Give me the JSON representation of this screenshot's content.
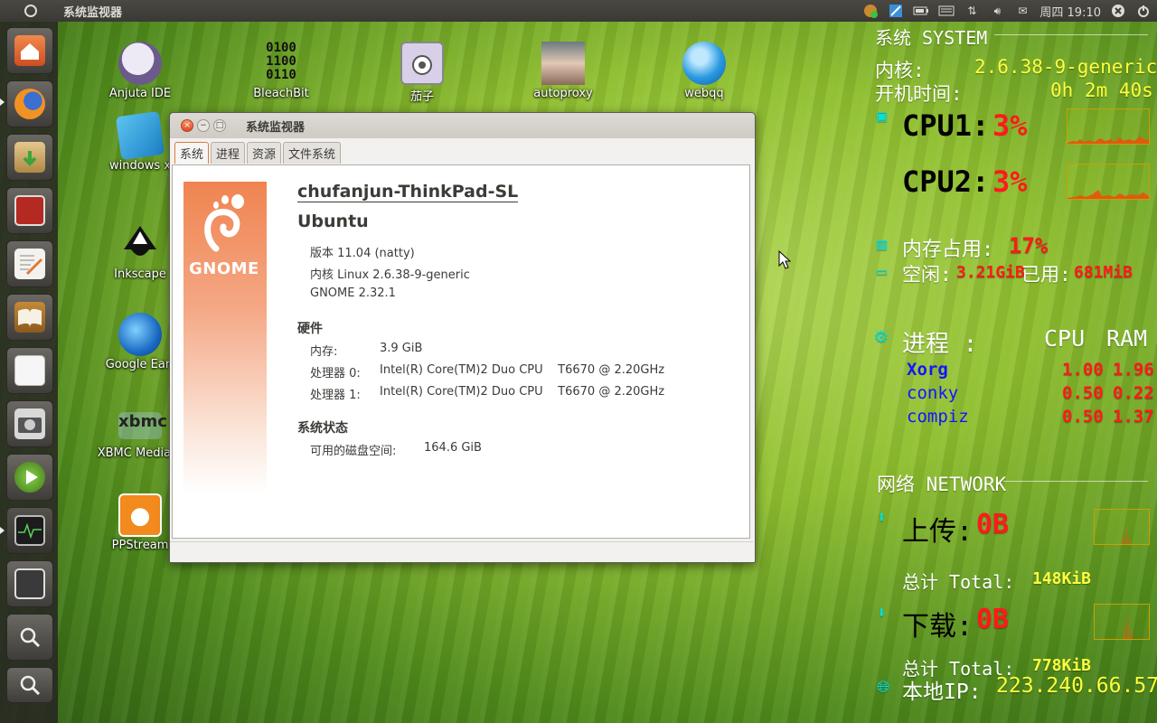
{
  "top_panel": {
    "app_title": "系统监视器",
    "clock": "周四 19:10",
    "tray_icons": [
      "notification-icon",
      "network-manager-icon",
      "battery-icon",
      "keyboard-icon",
      "transfer-icon",
      "volume-icon",
      "mail-icon",
      "power-icon"
    ]
  },
  "launcher": {
    "items": [
      "home-folder-icon",
      "firefox-icon",
      "software-center-icon",
      "terminal-icon",
      "text-editor-icon",
      "dictionary-icon",
      "libreoffice-icon",
      "camera-icon",
      "media-player-icon",
      "system-monitor-icon",
      "workspace-switcher-icon",
      "search-applications-icon",
      "search-files-icon"
    ]
  },
  "desktop_icons": [
    {
      "label": "Anjuta IDE"
    },
    {
      "label": "BleachBit"
    },
    {
      "label": "茄子"
    },
    {
      "label": "autoproxy"
    },
    {
      "label": "webqq"
    },
    {
      "label": "windows x"
    },
    {
      "label": "Inkscape"
    },
    {
      "label": "Google Eart"
    },
    {
      "label": "XBMC Media C"
    },
    {
      "label": "PPStream"
    }
  ],
  "bleachbit_digits": [
    "0100",
    "1100",
    "0110"
  ],
  "window": {
    "title": "系统监视器",
    "tabs": [
      "系统",
      "进程",
      "资源",
      "文件系统"
    ],
    "active_tab": "系统",
    "logo_text": "GNOME",
    "hostname": "chufanjun-ThinkPad-SL",
    "distro": "Ubuntu",
    "version": "版本 11.04 (natty)",
    "kernel": "内核 Linux 2.6.38-9-generic",
    "gnome": "GNOME 2.32.1",
    "hardware_title": "硬件",
    "memory_label": "内存:",
    "memory_value": "3.9 GiB",
    "cpu0_label": "处理器 0:",
    "cpu0_value": "Intel(R) Core(TM)2 Duo CPU    T6670 @ 2.20GHz",
    "cpu1_label": "处理器 1:",
    "cpu1_value": "Intel(R) Core(TM)2 Duo CPU    T6670 @ 2.20GHz",
    "status_title": "系统状态",
    "disk_label": "可用的磁盘空间:",
    "disk_value": "164.6 GiB"
  },
  "conky": {
    "system_title": "系统 SYSTEM",
    "kernel_label": "内核:",
    "kernel_value": "2.6.38-9-generic",
    "uptime_label": "开机时间:",
    "uptime_value": "0h 2m 40s",
    "cpu1_label": "CPU1:",
    "cpu1_value": "3%",
    "cpu2_label": "CPU2:",
    "cpu2_value": "3%",
    "mem_label": "内存占用:",
    "mem_value": "17%",
    "free_label": "空闲:",
    "free_value": "3.21GiB",
    "used_label": "已用:",
    "used_value": "681MiB",
    "proc_label": "进程 :",
    "proc_cpu": "CPU",
    "proc_ram": "RAM",
    "processes": [
      {
        "name": "Xorg",
        "cpu": "1.00",
        "ram": "1.96"
      },
      {
        "name": "conky",
        "cpu": "0.50",
        "ram": "0.22"
      },
      {
        "name": "compiz",
        "cpu": "0.50",
        "ram": "1.37"
      }
    ],
    "network_title": "网络 NETWORK",
    "upload_label": "上传:",
    "upload_value": "0B",
    "upload_total_label": "总计 Total:",
    "upload_total_value": "148KiB",
    "download_label": "下载:",
    "download_value": "0B",
    "download_total_label": "总计 Total:",
    "download_total_value": "778KiB",
    "ip_label": "本地IP:",
    "ip_value": "223.240.66.57"
  }
}
